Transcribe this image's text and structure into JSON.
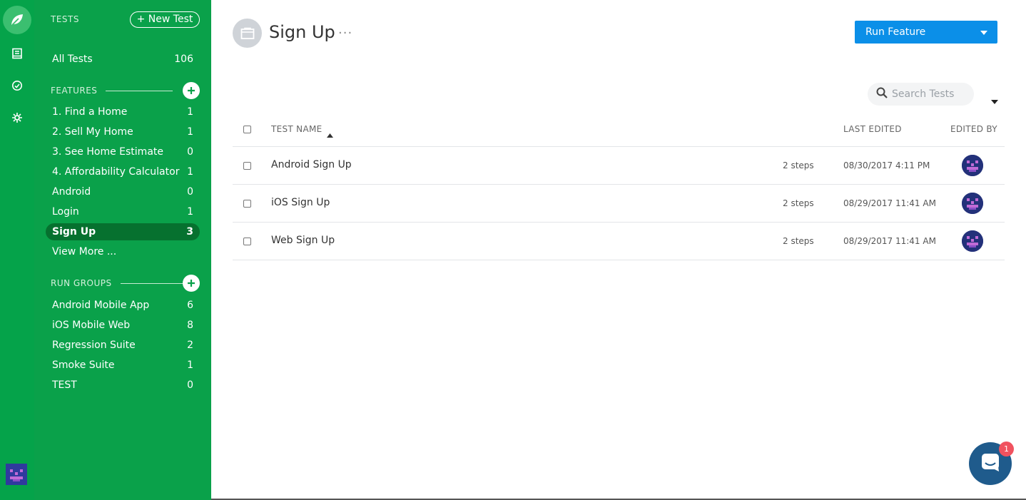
{
  "sidebar": {
    "tests_heading": "TESTS",
    "new_test_label": "+ New Test",
    "all_tests": {
      "label": "All Tests",
      "count": "106"
    },
    "features_heading": "FEATURES",
    "features": [
      {
        "label": "1. Find a Home",
        "count": "1"
      },
      {
        "label": "2. Sell My Home",
        "count": "1"
      },
      {
        "label": "3. See Home Estimate",
        "count": "0"
      },
      {
        "label": "4. Affordability Calculator",
        "count": "1"
      },
      {
        "label": "Android",
        "count": "0"
      },
      {
        "label": "Login",
        "count": "1"
      },
      {
        "label": "Sign Up",
        "count": "3"
      }
    ],
    "view_more": "View More ...",
    "run_groups_heading": "RUN GROUPS",
    "run_groups": [
      {
        "label": "Android Mobile App",
        "count": "6"
      },
      {
        "label": "iOS Mobile Web",
        "count": "8"
      },
      {
        "label": "Regression Suite",
        "count": "2"
      },
      {
        "label": "Smoke Suite",
        "count": "1"
      },
      {
        "label": "TEST",
        "count": "0"
      }
    ]
  },
  "header": {
    "title": "Sign Up",
    "more_label": "···",
    "run_button_label": "Run Feature"
  },
  "search": {
    "placeholder": "Search Tests"
  },
  "table": {
    "columns": {
      "name": "TEST NAME",
      "last_edited": "LAST EDITED",
      "edited_by": "EDITED BY"
    },
    "rows": [
      {
        "name": "Android Sign Up",
        "steps": "2 steps",
        "date": "08/30/2017 4:11 PM"
      },
      {
        "name": "iOS Sign Up",
        "steps": "2 steps",
        "date": "08/29/2017 11:41 AM"
      },
      {
        "name": "Web Sign Up",
        "steps": "2 steps",
        "date": "08/29/2017 11:41 AM"
      }
    ]
  },
  "chat": {
    "badge": "1"
  },
  "colors": {
    "sidebar_green": "#0aa14a",
    "active_green": "#06712f",
    "primary_blue": "#0b8fe8"
  },
  "icons": [
    "leaf-logo-icon",
    "tests-book-icon",
    "dashboard-icon",
    "settings-gear-icon",
    "search-icon",
    "caret-down-icon",
    "chat-icon"
  ]
}
